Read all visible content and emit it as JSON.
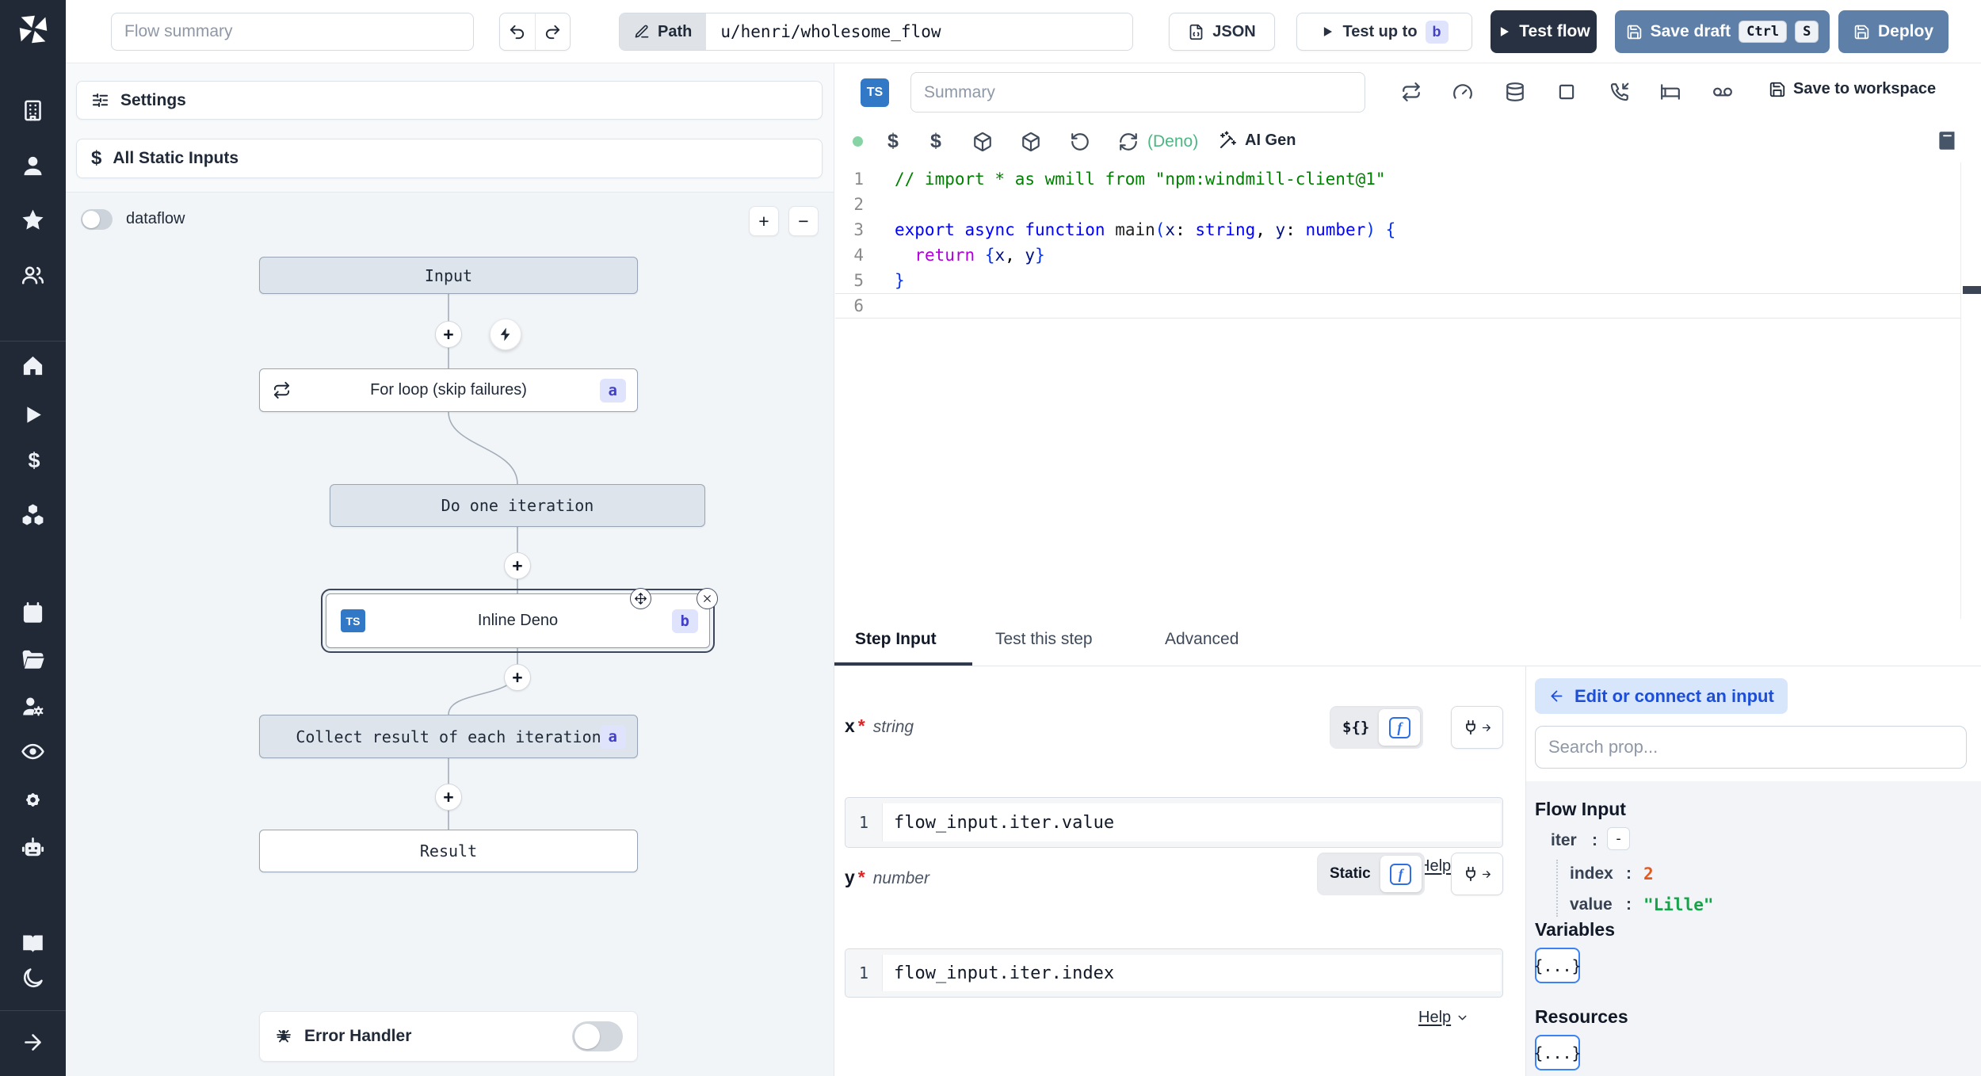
{
  "topbar": {
    "flow_summary_placeholder": "Flow summary",
    "path_label": "Path",
    "path_value": "u/henri/wholesome_flow",
    "json_label": "JSON",
    "test_up_to_label": "Test up to",
    "test_up_to_badge": "b",
    "test_flow_label": "Test flow",
    "save_draft_label": "Save draft",
    "save_draft_kbd": [
      "Ctrl",
      "S"
    ],
    "deploy_label": "Deploy"
  },
  "sidebar": {
    "icons": [
      "windmill-logo",
      "building",
      "user",
      "star",
      "users",
      "home",
      "play",
      "dollar",
      "boxes",
      "calendar",
      "folder-open",
      "users-cog",
      "eye",
      "gear",
      "robot",
      "book-open",
      "moon",
      "arrow-right"
    ]
  },
  "flow_panel": {
    "settings_label": "Settings",
    "static_inputs_label": "All Static Inputs",
    "dataflow_label": "dataflow",
    "zoom_in": "+",
    "zoom_out": "−",
    "nodes": {
      "input": {
        "label": "Input"
      },
      "forloop": {
        "label": "For loop (skip failures)",
        "badge": "a"
      },
      "do_one": {
        "label": "Do one iteration"
      },
      "inline": {
        "label": "Inline Deno",
        "badge": "b",
        "lang": "TS"
      },
      "collect": {
        "label": "Collect result of each iteration",
        "badge": "a"
      },
      "result": {
        "label": "Result"
      }
    },
    "error_handler_label": "Error Handler"
  },
  "editor": {
    "lang_badge": "TS",
    "summary_placeholder": "Summary",
    "save_to_workspace": "Save to workspace",
    "runtime": "(Deno)",
    "ai_gen": "AI Gen",
    "header_icons": [
      "repeat",
      "gauge",
      "database",
      "square",
      "phone-incoming",
      "bed",
      "voicemail"
    ],
    "toolbar_icons": [
      "status-dot",
      "dollar",
      "dollar",
      "package",
      "package",
      "rotate-ccw",
      "refresh-cw",
      "wand",
      "book"
    ]
  },
  "code": {
    "gutter": [
      "1",
      "2",
      "3",
      "4",
      "5",
      "6"
    ],
    "lines": [
      [
        {
          "c": "cmt",
          "t": "// import * as wmill from \"npm:windmill-client@1\""
        }
      ],
      [],
      [
        {
          "c": "kw",
          "t": "export"
        },
        {
          "c": "pl",
          "t": " "
        },
        {
          "c": "kw",
          "t": "async"
        },
        {
          "c": "pl",
          "t": " "
        },
        {
          "c": "kw",
          "t": "function"
        },
        {
          "c": "fn",
          "t": " main"
        },
        {
          "c": "br",
          "t": "("
        },
        {
          "c": "var",
          "t": "x"
        },
        {
          "c": "pl",
          "t": ": "
        },
        {
          "c": "kw",
          "t": "string"
        },
        {
          "c": "pl",
          "t": ", "
        },
        {
          "c": "var",
          "t": "y"
        },
        {
          "c": "pl",
          "t": ": "
        },
        {
          "c": "kw",
          "t": "number"
        },
        {
          "c": "br",
          "t": ") {"
        }
      ],
      [
        {
          "c": "pl",
          "t": "  "
        },
        {
          "c": "ctl",
          "t": "return"
        },
        {
          "c": "pl",
          "t": " "
        },
        {
          "c": "br",
          "t": "{"
        },
        {
          "c": "var",
          "t": "x"
        },
        {
          "c": "pl",
          "t": ", "
        },
        {
          "c": "var",
          "t": "y"
        },
        {
          "c": "br",
          "t": "}"
        }
      ],
      [
        {
          "c": "br",
          "t": "}"
        }
      ],
      []
    ]
  },
  "tabs": [
    "Step Input",
    "Test this step",
    "Advanced"
  ],
  "step_input": {
    "x": {
      "name": "x",
      "required": "*",
      "type": "string",
      "mode": "${}",
      "line": "1",
      "value": "flow_input.iter.value",
      "help": "Help"
    },
    "y": {
      "name": "y",
      "required": "*",
      "type": "number",
      "mode": "Static",
      "line": "1",
      "value": "flow_input.iter.index",
      "help": "Help"
    }
  },
  "props": {
    "back_label": "Edit or connect an input",
    "search_placeholder": "Search prop...",
    "flow_input_title": "Flow Input",
    "tree": {
      "iter_key": "iter",
      "colon": ":",
      "iter_value": "-",
      "index_key": "index",
      "index_value": "2",
      "value_key": "value",
      "value_value": "\"Lille\""
    },
    "variables_title": "Variables",
    "resources_title": "Resources",
    "braces": "{...}"
  },
  "colors": {
    "accent_blue": "#5e7fa8",
    "dark_navy": "#273142",
    "ts_blue": "#3178c6",
    "badge_indigo_bg": "#dfe4fc",
    "badge_indigo_text": "#4240c8",
    "deno_green": "#4cb782"
  }
}
